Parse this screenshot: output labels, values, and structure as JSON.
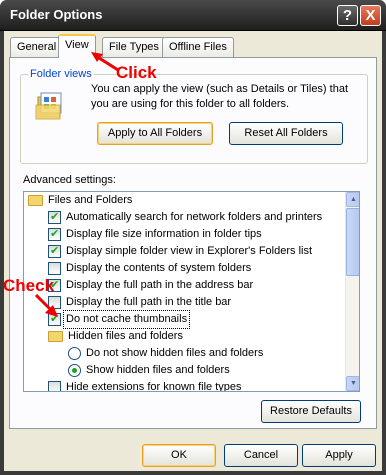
{
  "window": {
    "title": "Folder Options",
    "help_glyph": "?",
    "close_glyph": "X"
  },
  "tabs": [
    {
      "label": "General"
    },
    {
      "label": "View"
    },
    {
      "label": "File Types"
    },
    {
      "label": "Offline Files"
    }
  ],
  "folder_views": {
    "title": "Folder views",
    "description": "You can apply the view (such as Details or Tiles) that you are using for this folder to all folders.",
    "apply_button": "Apply to All Folders",
    "reset_button": "Reset All Folders"
  },
  "advanced": {
    "label": "Advanced settings:",
    "items": [
      {
        "type": "folder",
        "label": "Files and Folders"
      },
      {
        "type": "checkbox",
        "checked": true,
        "label": "Automatically search for network folders and printers"
      },
      {
        "type": "checkbox",
        "checked": true,
        "label": "Display file size information in folder tips"
      },
      {
        "type": "checkbox",
        "checked": true,
        "label": "Display simple folder view in Explorer's Folders list"
      },
      {
        "type": "checkbox",
        "checked": false,
        "label": "Display the contents of system folders"
      },
      {
        "type": "checkbox",
        "checked": true,
        "label": "Display the full path in the address bar"
      },
      {
        "type": "checkbox",
        "checked": false,
        "label": "Display the full path in the title bar"
      },
      {
        "type": "checkbox",
        "checked": true,
        "label": "Do not cache thumbnails"
      },
      {
        "type": "folder",
        "label": "Hidden files and folders"
      },
      {
        "type": "radio",
        "checked": false,
        "label": "Do not show hidden files and folders"
      },
      {
        "type": "radio",
        "checked": true,
        "label": "Show hidden files and folders"
      },
      {
        "type": "checkbox",
        "checked": false,
        "label": "Hide extensions for known file types"
      }
    ],
    "restore_button": "Restore Defaults"
  },
  "footer": {
    "ok": "OK",
    "cancel": "Cancel",
    "apply": "Apply"
  },
  "annotations": {
    "click": "Click",
    "check": "Check"
  },
  "colors": {
    "annotation": "#ee0000",
    "active_tab_accent": "#ffc83c",
    "group_title": "#0046d5"
  }
}
